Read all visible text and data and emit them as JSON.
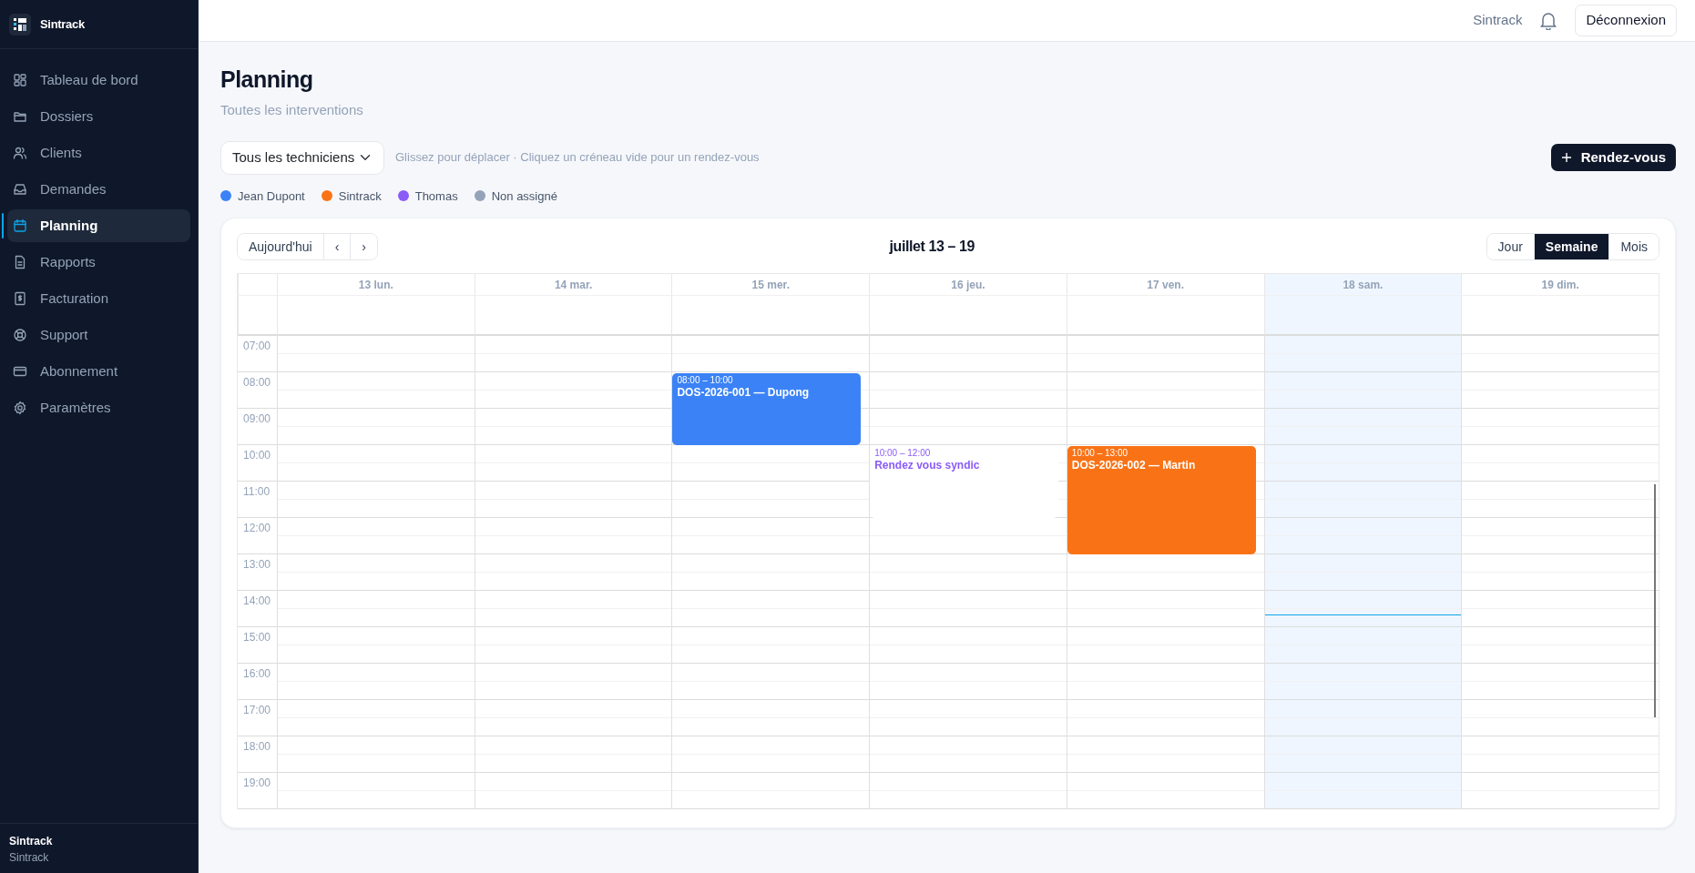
{
  "sidebar": {
    "brand": "Sintrack",
    "items": [
      {
        "label": "Tableau de bord",
        "selected": false
      },
      {
        "label": "Dossiers",
        "selected": false
      },
      {
        "label": "Clients",
        "selected": false
      },
      {
        "label": "Demandes",
        "selected": false
      },
      {
        "label": "Planning",
        "selected": true
      },
      {
        "label": "Rapports",
        "selected": false
      },
      {
        "label": "Facturation",
        "selected": false
      },
      {
        "label": "Support",
        "selected": false
      },
      {
        "label": "Abonnement",
        "selected": false
      },
      {
        "label": "Paramètres",
        "selected": false
      }
    ],
    "footer": {
      "name": "Sintrack",
      "org": "Sintrack"
    }
  },
  "topbar": {
    "user": "Sintrack",
    "logout": "Déconnexion"
  },
  "page": {
    "title": "Planning",
    "subtitle": "Toutes les interventions",
    "technician_select": {
      "value": "Tous les techniciens"
    },
    "hint": "Glissez pour déplacer · Cliquez un créneau vide pour un rendez-vous",
    "new_button": "Rendez-vous",
    "legend": [
      {
        "label": "Jean Dupont",
        "color": "#3b82f6"
      },
      {
        "label": "Sintrack",
        "color": "#f97316"
      },
      {
        "label": "Thomas",
        "color": "#8b5cf6"
      },
      {
        "label": "Non assigné",
        "color": "#94a3b8"
      }
    ]
  },
  "calendar": {
    "today_button": "Aujourd'hui",
    "prev": "‹",
    "next": "›",
    "range": "juillet 13 – 19",
    "views": [
      {
        "label": "Jour",
        "selected": false
      },
      {
        "label": "Semaine",
        "selected": true
      },
      {
        "label": "Mois",
        "selected": false
      }
    ],
    "days": [
      {
        "label": "13 lun.",
        "today": false
      },
      {
        "label": "14 mar.",
        "today": false
      },
      {
        "label": "15 mer.",
        "today": false,
        "events": [
          {
            "time": "08:00 – 10:00",
            "title": "DOS-2026-001 — Dupong",
            "color": "#3b82f6",
            "kind": "filled"
          }
        ]
      },
      {
        "label": "16 jeu.",
        "today": false,
        "events": [
          {
            "time": "10:00 – 12:00",
            "title": "Rendez vous syndic",
            "color": "#8b5cf6",
            "kind": "outline"
          }
        ]
      },
      {
        "label": "17 ven.",
        "today": false,
        "events": [
          {
            "time": "10:00 – 13:00",
            "title": "DOS-2026-002 — Martin",
            "color": "#f97316",
            "kind": "filled"
          }
        ]
      },
      {
        "label": "18 sam.",
        "today": true
      },
      {
        "label": "19 dim.",
        "today": false
      }
    ],
    "hours": [
      "07:00",
      "08:00",
      "09:00",
      "10:00",
      "11:00",
      "12:00",
      "13:00",
      "14:00",
      "15:00",
      "16:00",
      "17:00",
      "18:00",
      "19:00"
    ],
    "now_line": {
      "level": 0.59
    }
  }
}
